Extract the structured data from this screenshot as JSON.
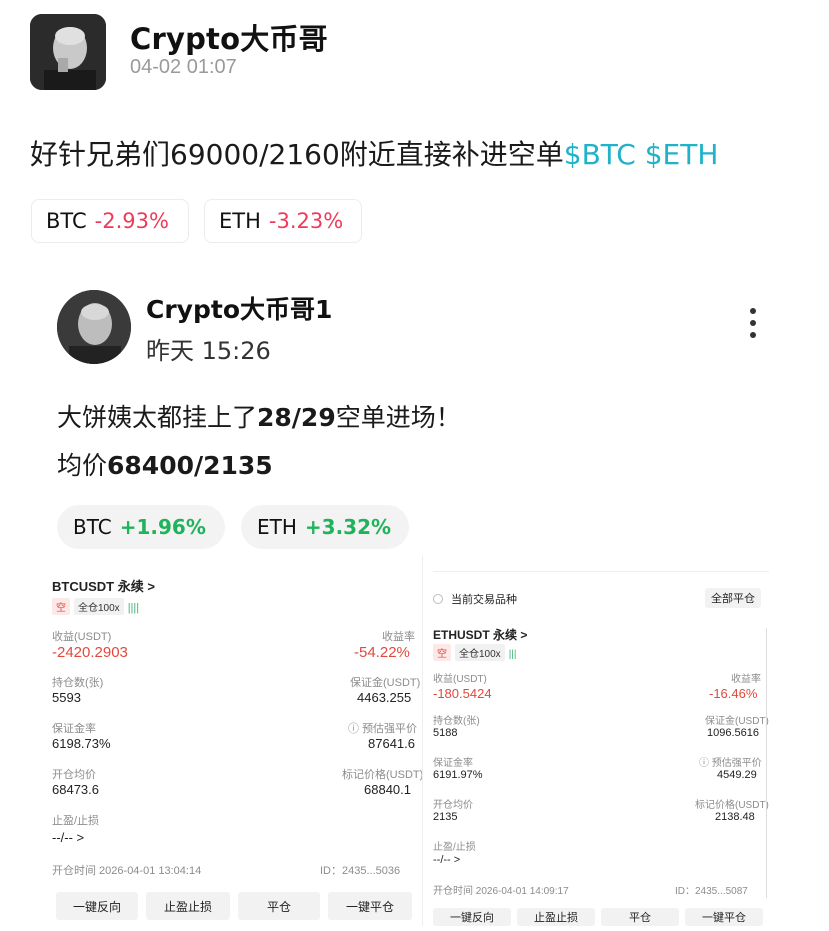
{
  "post": {
    "author": "Crypto大币哥",
    "time": "04-02 01:07",
    "text": "好针兄弟们69000/2160附近直接补进空单",
    "cashtags": "$BTC $ETH",
    "chips": [
      {
        "symbol": "BTC",
        "change": "-2.93%"
      },
      {
        "symbol": "ETH",
        "change": "-3.23%"
      }
    ]
  },
  "quote": {
    "author": "Crypto大币哥1",
    "time": "昨天 15:26",
    "line1_prefix": "大饼姨太都挂上了",
    "line1_bold": "28/29",
    "line1_suffix": "空单进场！",
    "line2_prefix": "均价",
    "line2_bold": "68400/2135",
    "chips": [
      {
        "symbol": "BTC",
        "change": "+1.96%"
      },
      {
        "symbol": "ETH",
        "change": "+3.32%"
      }
    ]
  },
  "btc_panel": {
    "title": "BTCUSDT 永续 >",
    "tag_side": "空",
    "tag_mode": "全仓100x",
    "pnl_label": "收益(USDT)",
    "pnl_value": "-2420.2903",
    "roe_label": "收益率",
    "roe_value": "-54.22%",
    "qty_label": "持仓数(张)",
    "qty_value": "5593",
    "margin_label": "保证金(USDT)",
    "margin_value": "4463.255",
    "mratio_label": "保证金率",
    "mratio_value": "6198.73%",
    "liq_label": "预估强平价",
    "liq_value": "87641.6",
    "entry_label": "开仓均价",
    "entry_value": "68473.6",
    "mark_label": "标记价格(USDT)",
    "mark_value": "68840.1",
    "tpsl_label": "止盈/止损",
    "tpsl_value": "--/-- >",
    "open_time": "开仓时间 2026-04-01 13:04:14",
    "id": "ID：2435...5036",
    "buttons": [
      "一键反向",
      "止盈止损",
      "平仓",
      "一键平仓"
    ]
  },
  "eth_panel": {
    "filter_label": "当前交易品种",
    "close_all": "全部平仓",
    "title": "ETHUSDT 永续 >",
    "tag_side": "空",
    "tag_mode": "全仓100x",
    "pnl_label": "收益(USDT)",
    "pnl_value": "-180.5424",
    "roe_label": "收益率",
    "roe_value": "-16.46%",
    "qty_label": "持仓数(张)",
    "qty_value": "5188",
    "margin_label": "保证金(USDT)",
    "margin_value": "1096.5616",
    "mratio_label": "保证金率",
    "mratio_value": "6191.97%",
    "liq_label": "预估强平价",
    "liq_value": "4549.29",
    "entry_label": "开仓均价",
    "entry_value": "2135",
    "mark_label": "标记价格(USDT)",
    "mark_value": "2138.48",
    "tpsl_label": "止盈/止损",
    "tpsl_value": "--/-- >",
    "open_time": "开仓时间 2026-04-01 14:09:17",
    "id": "ID：2435...5087",
    "buttons": [
      "一键反向",
      "止盈止损",
      "平仓",
      "一键平仓"
    ]
  }
}
